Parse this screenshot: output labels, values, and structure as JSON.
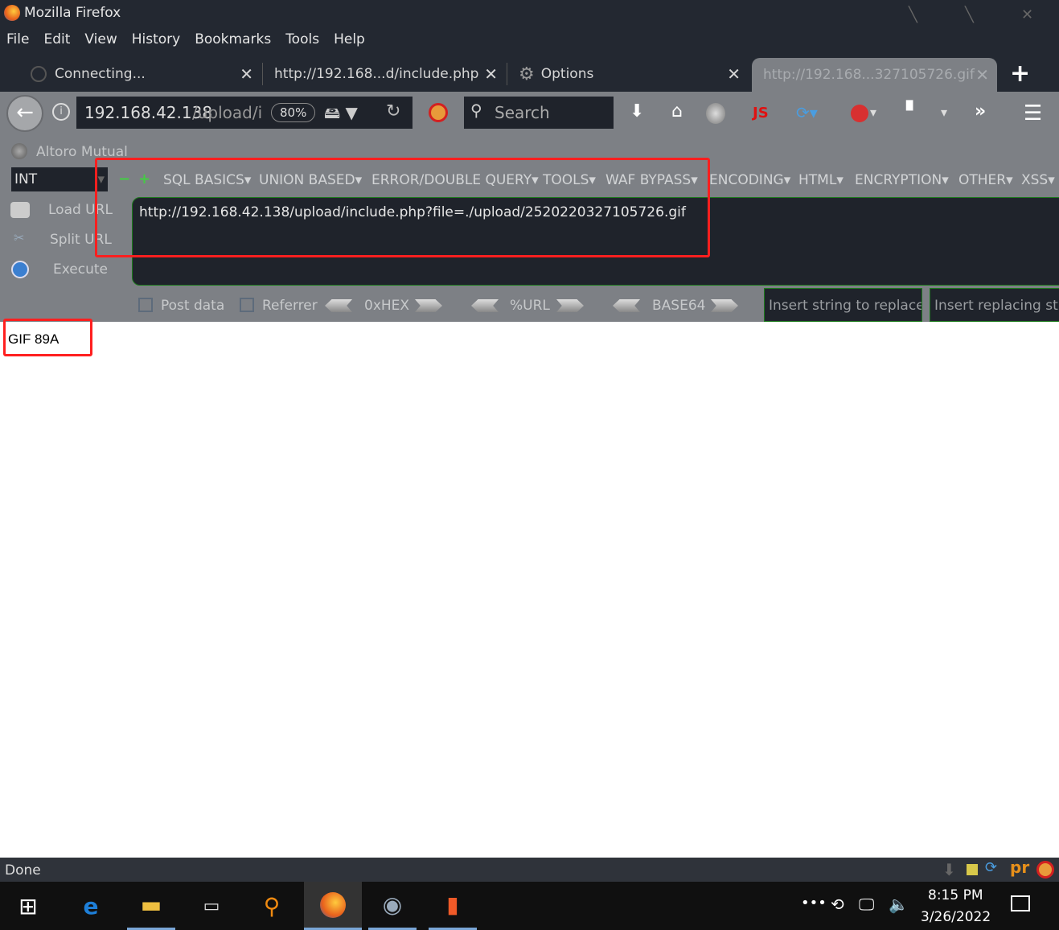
{
  "window": {
    "title": "Mozilla Firefox"
  },
  "menu": [
    "File",
    "Edit",
    "View",
    "History",
    "Bookmarks",
    "Tools",
    "Help"
  ],
  "tabs": [
    {
      "label": "Connecting..."
    },
    {
      "label": "http://192.168...d/include.php"
    },
    {
      "label": "Options"
    },
    {
      "label": "http://192.168...327105726.gif",
      "active": true
    }
  ],
  "navbar": {
    "url_host": "192.168.42.138",
    "url_path": "/upload/i",
    "zoom": "80%",
    "search_placeholder": "Search",
    "js_label": "JS"
  },
  "bookmarks": [
    {
      "label": "Altoro Mutual"
    }
  ],
  "hackbar": {
    "type_select": "INT",
    "menus": [
      "SQL BASICS",
      "UNION BASED",
      "ERROR/DOUBLE QUERY",
      "TOOLS",
      "WAF BYPASS",
      "ENCODING",
      "HTML",
      "ENCRYPTION",
      "OTHER",
      "XSS"
    ],
    "actions": [
      "Load URL",
      "Split URL",
      "Execute"
    ],
    "url_value": "http://192.168.42.138/upload/include.php?file=./upload/2520220327105726.gif",
    "post_data": "Post data",
    "referrer": "Referrer",
    "encoders": [
      "0xHEX",
      "%URL",
      "BASE64"
    ],
    "replace_placeholder": "Insert string to replace",
    "replacing_placeholder": "Insert replacing string"
  },
  "content": {
    "text": "GIF 89A"
  },
  "status": {
    "text": "Done"
  },
  "taskbar": {
    "time": "8:15 PM",
    "date": "3/26/2022"
  },
  "colors": {
    "highlight": "#ff1f1f",
    "chrome": "#7d8085",
    "dark": "#1f232b"
  }
}
